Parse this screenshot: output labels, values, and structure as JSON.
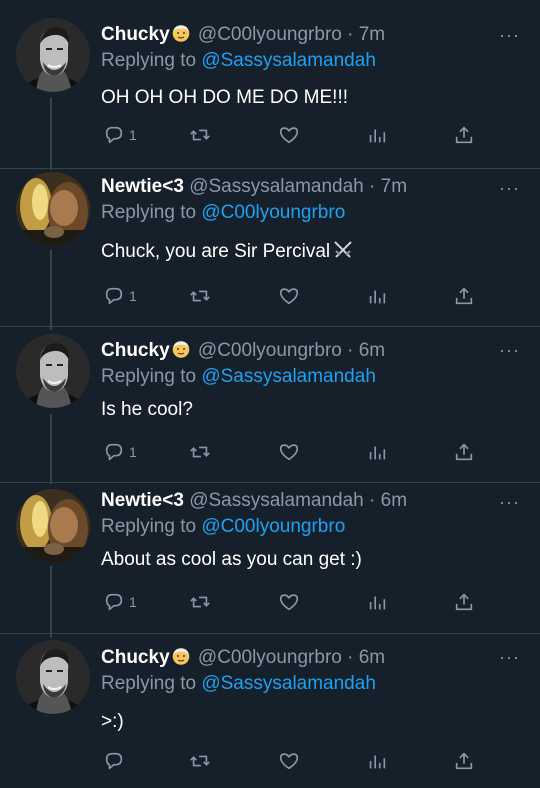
{
  "tweets": [
    {
      "avatar": "giga-chad-avatar",
      "name": "Chucky",
      "name_emoji": "older-man-emoji",
      "handle": "@C00lyoungrbro",
      "dot": "·",
      "time": "7m",
      "reply_prefix": "Replying to",
      "reply_to": "@Sassysalamandah",
      "text": "OH OH OH DO ME DO ME!!!",
      "reply_count": "1"
    },
    {
      "avatar": "newtie-avatar",
      "name": "Newtie<3",
      "handle": "@Sassysalamandah",
      "dot": "·",
      "time": "7m",
      "reply_prefix": "Replying to",
      "reply_to": "@C00lyoungrbro",
      "text": "Chuck, you are Sir Percival",
      "text_emoji": "crossed-swords-emoji",
      "reply_count": "1"
    },
    {
      "avatar": "giga-chad-avatar",
      "name": "Chucky",
      "name_emoji": "older-man-emoji",
      "handle": "@C00lyoungrbro",
      "dot": "·",
      "time": "6m",
      "reply_prefix": "Replying to",
      "reply_to": "@Sassysalamandah",
      "text": "Is he cool?",
      "reply_count": "1"
    },
    {
      "avatar": "newtie-avatar",
      "name": "Newtie<3",
      "handle": "@Sassysalamandah",
      "dot": "·",
      "time": "6m",
      "reply_prefix": "Replying to",
      "reply_to": "@C00lyoungrbro",
      "text": "About as cool as you can get :)",
      "reply_count": "1"
    },
    {
      "avatar": "giga-chad-avatar",
      "name": "Chucky",
      "name_emoji": "older-man-emoji",
      "handle": "@C00lyoungrbro",
      "dot": "·",
      "time": "6m",
      "reply_prefix": "Replying to",
      "reply_to": "@Sassysalamandah",
      "text": ">:)",
      "reply_count": ""
    }
  ],
  "more_label": "···",
  "icons": {
    "reply": "reply-icon",
    "retweet": "retweet-icon",
    "like": "heart-icon",
    "analytics": "analytics-icon",
    "share": "share-icon",
    "more": "more-icon"
  },
  "colors": {
    "background": "#15202b",
    "text": "#ffffff",
    "muted": "#8899a6",
    "link": "#1da1f2",
    "divider": "#38444d"
  }
}
